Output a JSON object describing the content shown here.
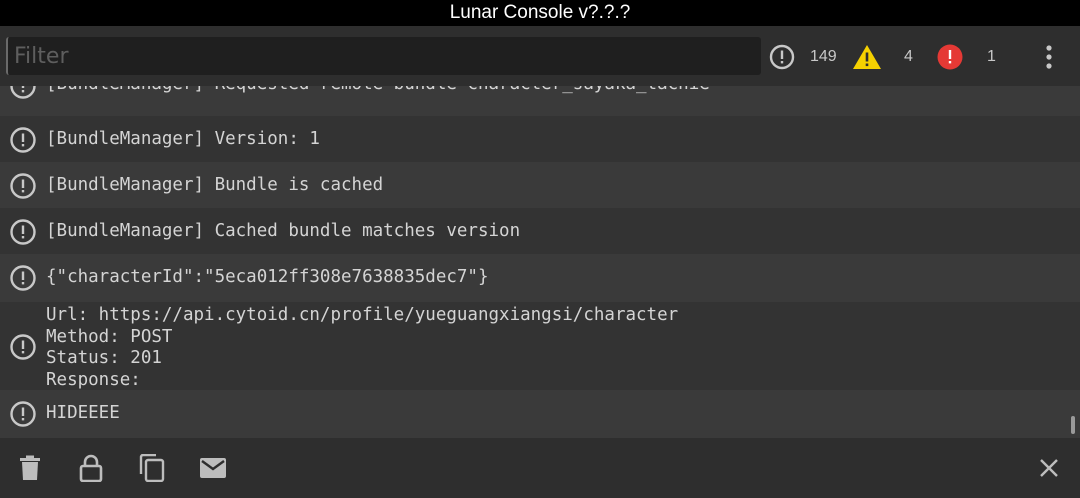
{
  "window": {
    "title": "Lunar Console v?.?.?"
  },
  "filter": {
    "placeholder": "Filter",
    "value": ""
  },
  "counters": {
    "log": "149",
    "warning": "4",
    "error": "1"
  },
  "colors": {
    "warning": "#f5d100",
    "error": "#e53935",
    "icon": "#c8c8c8"
  },
  "logs": [
    {
      "text": "[BundleManager] Requested remote bundle character_sayaka_tachie",
      "icon": "info-circle-icon"
    },
    {
      "text": "[BundleManager] Version: 1",
      "icon": "info-circle-icon"
    },
    {
      "text": "[BundleManager] Bundle is cached",
      "icon": "info-circle-icon"
    },
    {
      "text": "[BundleManager] Cached bundle matches version",
      "icon": "info-circle-icon"
    },
    {
      "text": "{\"characterId\":\"5eca012ff308e7638835dec7\"}",
      "icon": "info-circle-icon"
    },
    {
      "text": "Url: https://api.cytoid.cn/profile/yueguangxiangsi/character\nMethod: POST\nStatus: 201\nResponse:",
      "icon": "info-circle-icon"
    },
    {
      "text": "HIDEEEE",
      "icon": "info-circle-icon"
    }
  ],
  "bottom_icons": [
    "trash-icon",
    "lock-icon",
    "copy-icon",
    "email-icon",
    "close-icon"
  ]
}
